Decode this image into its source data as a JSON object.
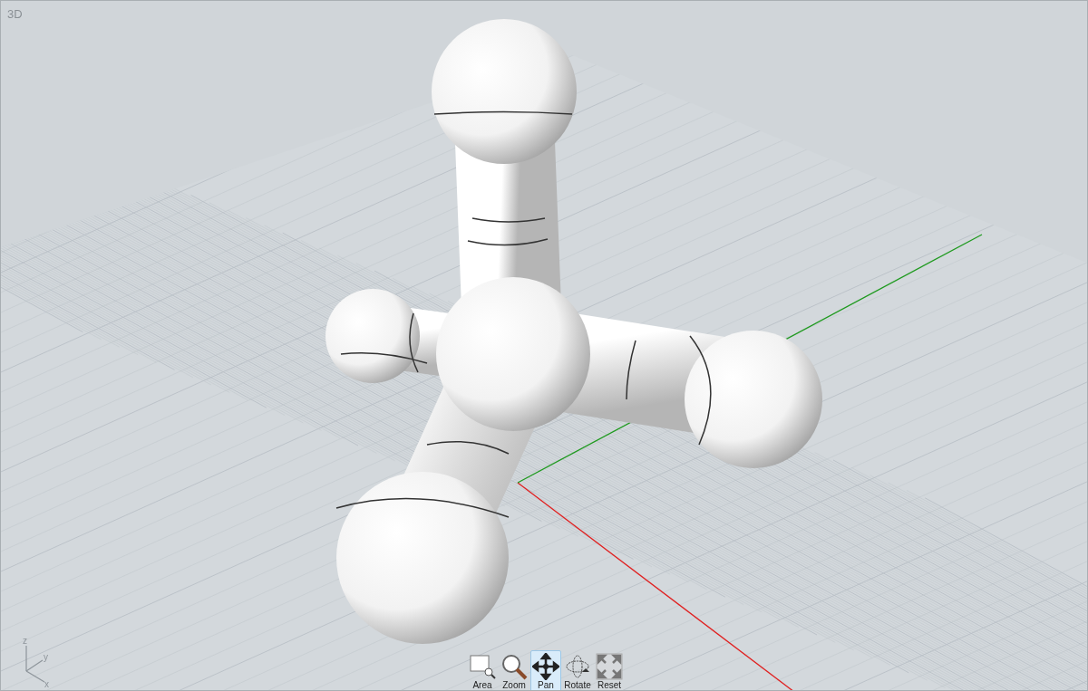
{
  "viewport": {
    "title": "3D",
    "axis_labels": {
      "z": "z",
      "y": "y",
      "x": "x"
    }
  },
  "tools": [
    {
      "kind": "area",
      "label": "Area",
      "selected": false
    },
    {
      "kind": "zoom",
      "label": "Zoom",
      "selected": false
    },
    {
      "kind": "pan",
      "label": "Pan",
      "selected": true
    },
    {
      "kind": "rotate",
      "label": "Rotate",
      "selected": false
    },
    {
      "kind": "reset",
      "label": "Reset",
      "selected": false
    }
  ]
}
